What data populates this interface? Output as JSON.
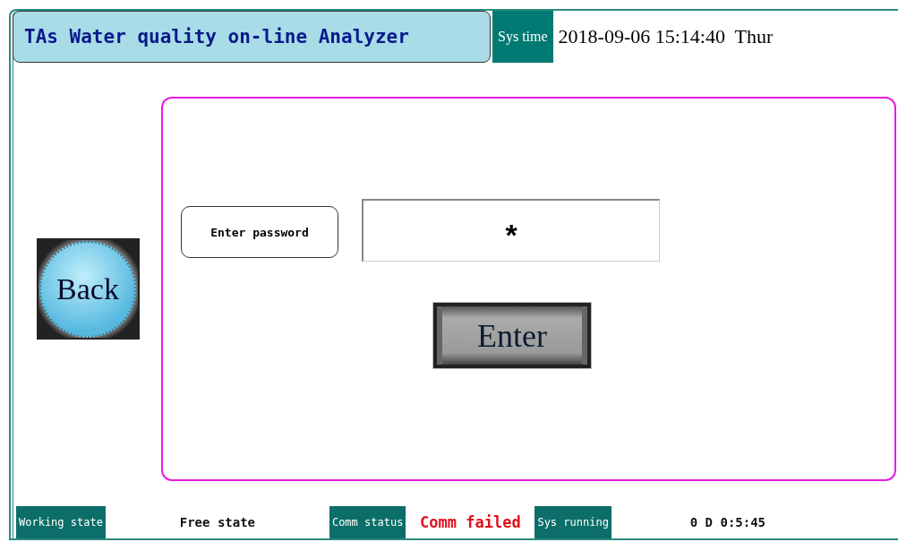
{
  "header": {
    "title": "TAs Water quality on-line Analyzer",
    "time_label": "Sys time",
    "time_value": "2018-09-06 15:14:40  Thur"
  },
  "back_button": {
    "label": "Back"
  },
  "login": {
    "label": "Enter password",
    "password": {
      "value": "*"
    },
    "enter_button": "Enter"
  },
  "status_bar": [
    {
      "label": "Working state",
      "value": "Free state",
      "alert": false
    },
    {
      "label": "Comm status",
      "value": "Comm failed",
      "alert": true
    },
    {
      "label": "Sys running",
      "value": "0 D 0:5:45",
      "alert": false
    }
  ]
}
